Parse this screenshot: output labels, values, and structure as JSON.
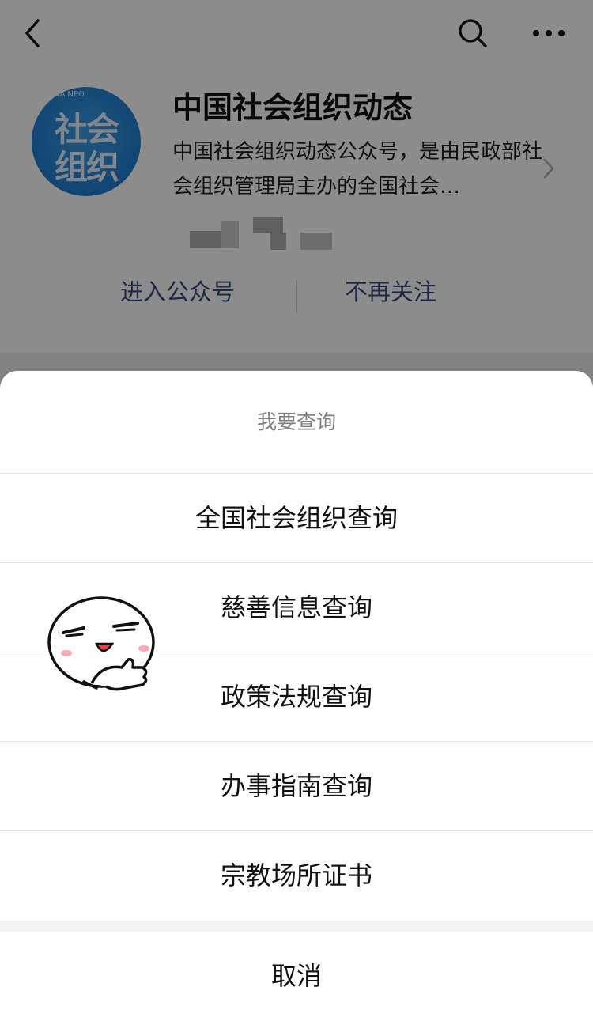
{
  "profile": {
    "avatar_text_small": "NA NPO",
    "avatar_text_line1": "社会",
    "avatar_text_line2": "组织",
    "name": "中国社会组织动态",
    "description": "中国社会组织动态公众号，是由民政部社会组织管理局主办的全国社会…",
    "enter_label": "进入公众号",
    "unfollow_label": "不再关注"
  },
  "topbar": {
    "back_icon": "chevron-left-icon",
    "search_icon": "search-icon",
    "more_icon": "more-icon"
  },
  "action_sheet": {
    "title": "我要查询",
    "items": [
      "全国社会组织查询",
      "慈善信息查询",
      "政策法规查询",
      "办事指南查询",
      "宗教场所证书"
    ],
    "cancel_label": "取消"
  },
  "colors": {
    "link": "#3c4a7a",
    "avatar_bg": "#1f7fcf",
    "overlay": "rgba(0,0,0,0.45)"
  }
}
